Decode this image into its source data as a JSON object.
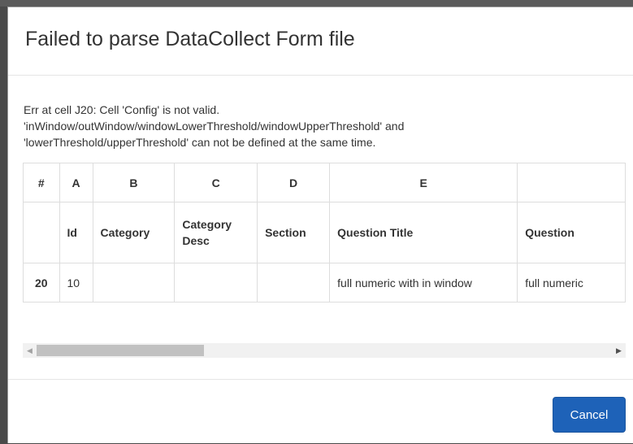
{
  "dialog": {
    "title": "Failed to parse DataCollect Form file",
    "error_lines": [
      "Err at cell J20: Cell 'Config' is not valid.",
      "'inWindow/outWindow/windowLowerThreshold/windowUpperThreshold' and",
      "'lowerThreshold/upperThreshold' can not be defined at the same time."
    ],
    "table": {
      "column_letters": [
        "#",
        "A",
        "B",
        "C",
        "D",
        "E",
        ""
      ],
      "header_row": [
        "",
        "Id",
        "Category",
        "Category Desc",
        "Section",
        "Question Title",
        "Question"
      ],
      "data_row": [
        "20",
        "10",
        "",
        "",
        "",
        "full numeric with in window",
        "full numeric"
      ]
    },
    "scrollbar": {
      "left_arrow": "◀",
      "right_arrow": "▶"
    },
    "cancel_label": "Cancel"
  },
  "colors": {
    "primary_button": "#1e62b8",
    "border": "#dddddd"
  }
}
